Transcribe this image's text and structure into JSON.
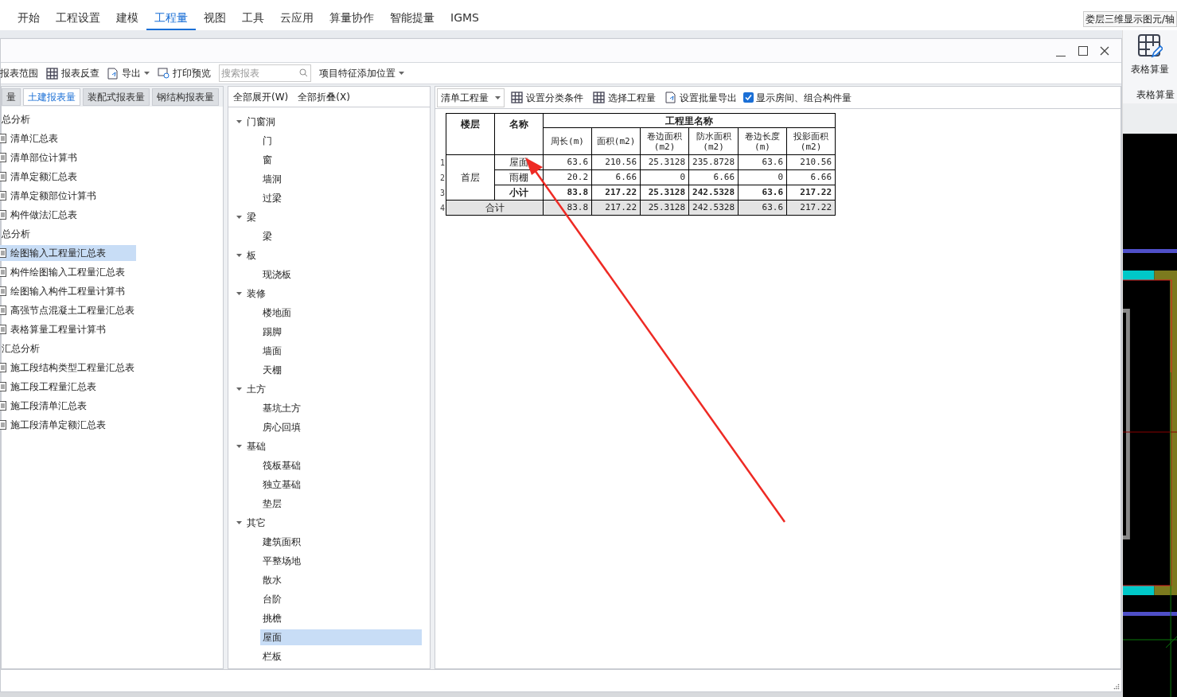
{
  "menu": [
    {
      "label": "开始",
      "selected": false
    },
    {
      "label": "工程设置",
      "selected": false
    },
    {
      "label": "建模",
      "selected": false
    },
    {
      "label": "工程量",
      "selected": true
    },
    {
      "label": "视图",
      "selected": false
    },
    {
      "label": "工具",
      "selected": false
    },
    {
      "label": "云应用",
      "selected": false
    },
    {
      "label": "算量协作",
      "selected": false
    },
    {
      "label": "智能提量",
      "selected": false
    },
    {
      "label": "IGMS",
      "selected": false
    }
  ],
  "top_right_label": "娄层三维显示图元/轴",
  "ribbon": {
    "button": "表格算量",
    "group": "表格算量"
  },
  "dialog": {
    "toolbar": {
      "report_range": "报表范围",
      "report_check": "报表反查",
      "export": "导出",
      "print_preview": "打印预览",
      "search": {
        "placeholder": "搜索报表"
      },
      "feature_position": "项目特征添加位置"
    },
    "report_tabs": [
      {
        "label": "量",
        "selected": false
      },
      {
        "label": "土建报表量",
        "selected": true
      },
      {
        "label": "装配式报表量",
        "selected": false
      },
      {
        "label": "钢结构报表量",
        "selected": false
      }
    ],
    "report_tree": [
      {
        "label": "总分析",
        "children": [
          {
            "label": "清单汇总表",
            "selected": false
          },
          {
            "label": "清单部位计算书",
            "selected": false
          },
          {
            "label": "清单定额汇总表",
            "selected": false
          },
          {
            "label": "清单定额部位计算书",
            "selected": false
          },
          {
            "label": "构件做法汇总表",
            "selected": false
          }
        ]
      },
      {
        "label": "总分析",
        "children": [
          {
            "label": "绘图输入工程量汇总表",
            "selected": true
          },
          {
            "label": "构件绘图输入工程量汇总表",
            "selected": false
          },
          {
            "label": "绘图输入构件工程量计算书",
            "selected": false
          },
          {
            "label": "高强节点混凝土工程量汇总表",
            "selected": false
          },
          {
            "label": "表格算量工程量计算书",
            "selected": false
          }
        ]
      },
      {
        "label": "汇总分析",
        "children": [
          {
            "label": "施工段结构类型工程量汇总表",
            "selected": false
          },
          {
            "label": "施工段工程量汇总表",
            "selected": false
          },
          {
            "label": "施工段清单汇总表",
            "selected": false
          },
          {
            "label": "施工段清单定额汇总表",
            "selected": false
          }
        ]
      }
    ],
    "expand_all": "全部展开(W)",
    "collapse_all": "全部折叠(X)",
    "component_tree": [
      {
        "label": "门窗洞",
        "expanded": true,
        "children": [
          {
            "label": "门",
            "selected": false
          },
          {
            "label": "窗",
            "selected": false
          },
          {
            "label": "墙洞",
            "selected": false
          },
          {
            "label": "过梁",
            "selected": false
          }
        ]
      },
      {
        "label": "梁",
        "expanded": true,
        "children": [
          {
            "label": "梁",
            "selected": false
          }
        ]
      },
      {
        "label": "板",
        "expanded": true,
        "children": [
          {
            "label": "现浇板",
            "selected": false
          }
        ]
      },
      {
        "label": "装修",
        "expanded": true,
        "children": [
          {
            "label": "楼地面",
            "selected": false
          },
          {
            "label": "踢脚",
            "selected": false
          },
          {
            "label": "墙面",
            "selected": false
          },
          {
            "label": "天棚",
            "selected": false
          }
        ]
      },
      {
        "label": "土方",
        "expanded": true,
        "children": [
          {
            "label": "基坑土方",
            "selected": false
          },
          {
            "label": "房心回填",
            "selected": false
          }
        ]
      },
      {
        "label": "基础",
        "expanded": true,
        "children": [
          {
            "label": "筏板基础",
            "selected": false
          },
          {
            "label": "独立基础",
            "selected": false
          },
          {
            "label": "垫层",
            "selected": false
          }
        ]
      },
      {
        "label": "其它",
        "expanded": true,
        "children": [
          {
            "label": "建筑面积",
            "selected": false
          },
          {
            "label": "平整场地",
            "selected": false
          },
          {
            "label": "散水",
            "selected": false
          },
          {
            "label": "台阶",
            "selected": false
          },
          {
            "label": "挑檐",
            "selected": false
          },
          {
            "label": "屋面",
            "selected": true
          },
          {
            "label": "栏板",
            "selected": false
          }
        ]
      }
    ],
    "result_toolbar": {
      "quantity_type": "清单工程量",
      "set_classification": "设置分类条件",
      "select_quantity": "选择工程量",
      "batch_export": "设置批量导出",
      "show_rooms": {
        "label": "显示房间、组合构件量",
        "checked": true
      }
    },
    "table": {
      "floor_header": "楼层",
      "name_header": "名称",
      "group_header": "工程里名称",
      "columns": [
        "周长(m)",
        "面积(m2)",
        "卷边面积(m2)",
        "防水面积(m2)",
        "卷边长度(m)",
        "投影面积(m2)"
      ],
      "groups": [
        {
          "floor": "首层",
          "rows": [
            {
              "number": "1",
              "name": "屋面",
              "kind": "item",
              "values": [
                "63.6",
                "210.56",
                "25.3128",
                "235.8728",
                "63.6",
                "210.56"
              ]
            },
            {
              "number": "2",
              "name": "雨棚",
              "kind": "item",
              "values": [
                "20.2",
                "6.66",
                "0",
                "6.66",
                "0",
                "6.66"
              ]
            },
            {
              "number": "3",
              "name": "小计",
              "kind": "subtotal",
              "values": [
                "83.8",
                "217.22",
                "25.3128",
                "242.5328",
                "63.6",
                "217.22"
              ]
            }
          ]
        }
      ],
      "total": {
        "number": "4",
        "label": "合计",
        "values": [
          "83.8",
          "217.22",
          "25.3128",
          "242.5328",
          "63.6",
          "217.22"
        ]
      }
    }
  }
}
